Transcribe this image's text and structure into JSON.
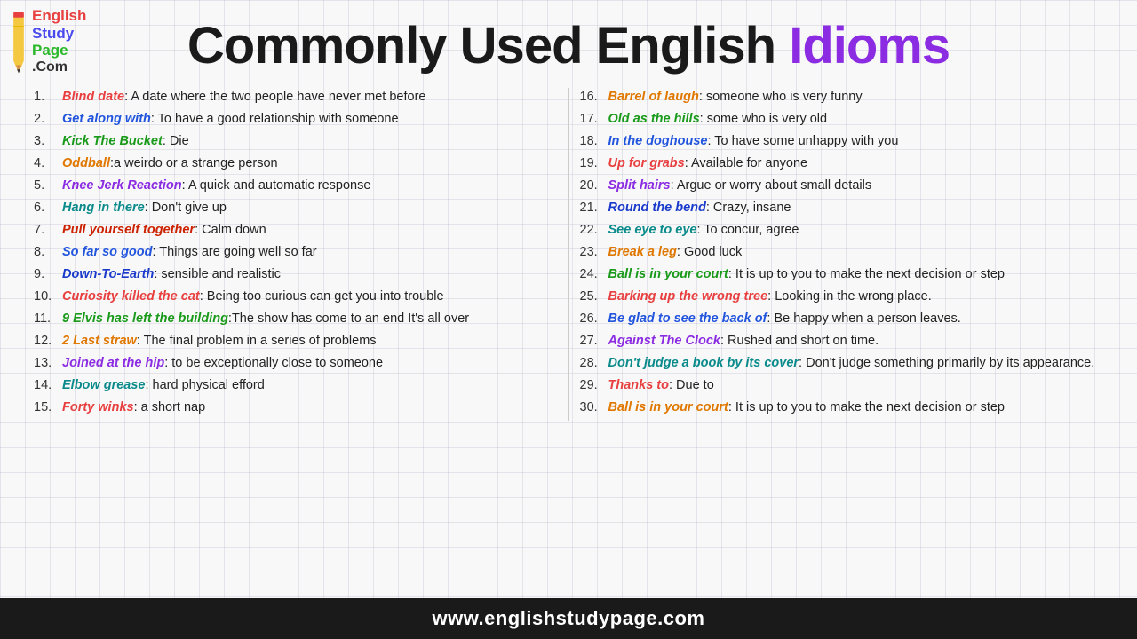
{
  "logo": {
    "english": "English",
    "study": "Study",
    "page": "Page",
    "com": ".Com"
  },
  "title": {
    "black_part": "Commonly Used English ",
    "purple_part": "Idioms"
  },
  "left_idioms": [
    {
      "num": "1.",
      "phrase": "Blind date",
      "color": "c-red",
      "definition": ": A date where the two people have never met before"
    },
    {
      "num": "2.",
      "phrase": "Get along with",
      "color": "c-blue",
      "definition": ": To have a good relationship with someone"
    },
    {
      "num": "3.",
      "phrase": "Kick The Bucket",
      "color": "c-green",
      "definition": ": Die"
    },
    {
      "num": "4.",
      "phrase": "Oddball",
      "color": "c-orange",
      "definition": ":a weirdo or a strange person"
    },
    {
      "num": "5.",
      "phrase": "Knee Jerk Reaction",
      "color": "c-purple",
      "definition": ": A quick and automatic response"
    },
    {
      "num": "6.",
      "phrase": "Hang in there",
      "color": "c-teal",
      "definition": ": Don't give up"
    },
    {
      "num": "7.",
      "phrase": "Pull yourself together",
      "color": "c-darkred",
      "definition": ": Calm down"
    },
    {
      "num": "8.",
      "phrase": "So far so good",
      "color": "c-blue",
      "definition": ": Things are going well so far"
    },
    {
      "num": "9.",
      "phrase": "Down-To-Earth",
      "color": "c-navy",
      "definition": ": sensible and realistic"
    },
    {
      "num": "10.",
      "phrase": "Curiosity killed the cat",
      "color": "c-red",
      "definition": ": Being too curious can get you into trouble"
    },
    {
      "num": "11.",
      "phrase": "9 Elvis has left the building",
      "color": "c-green",
      "definition": ":The show has come to an end It's all over"
    },
    {
      "num": "12.",
      "phrase": "2 Last straw",
      "color": "c-orange",
      "definition": ": The final problem in a series of problems"
    },
    {
      "num": "13.",
      "phrase": "Joined at the hip",
      "color": "c-purple",
      "definition": ": to be exceptionally close to someone"
    },
    {
      "num": "14.",
      "phrase": "Elbow grease",
      "color": "c-teal",
      "definition": ": hard physical efford"
    },
    {
      "num": "15.",
      "phrase": "Forty winks",
      "color": "c-red",
      "definition": ": a short nap"
    }
  ],
  "right_idioms": [
    {
      "num": "16.",
      "phrase": "Barrel of laugh",
      "color": "c-orange",
      "definition": ": someone who is very funny"
    },
    {
      "num": "17.",
      "phrase": "Old as the hills",
      "color": "c-green",
      "definition": ": some who is very old"
    },
    {
      "num": "18.",
      "phrase": "In the doghouse",
      "color": "c-blue",
      "definition": ": To have some unhappy with you"
    },
    {
      "num": "19.",
      "phrase": "Up for grabs",
      "color": "c-red",
      "definition": ": Available for anyone"
    },
    {
      "num": "20.",
      "phrase": "Split hairs",
      "color": "c-purple",
      "definition": ": Argue or worry about small details"
    },
    {
      "num": "21.",
      "phrase": "Round the bend",
      "color": "c-navy",
      "definition": ": Crazy, insane"
    },
    {
      "num": "22.",
      "phrase": "See eye to eye",
      "color": "c-teal",
      "definition": ": To concur, agree"
    },
    {
      "num": "23.",
      "phrase": "Break a leg",
      "color": "c-orange",
      "definition": ": Good luck"
    },
    {
      "num": "24.",
      "phrase": "Ball is in your court",
      "color": "c-green",
      "definition": ": It is up to you to make the next decision or step"
    },
    {
      "num": "25.",
      "phrase": "Barking up the wrong tree",
      "color": "c-red",
      "definition": ": Looking in the wrong place."
    },
    {
      "num": "26.",
      "phrase": "Be glad to see the back of",
      "color": "c-blue",
      "definition": ": Be happy when a person leaves."
    },
    {
      "num": "27.",
      "phrase": "Against The Clock",
      "color": "c-purple",
      "definition": ": Rushed and short on time."
    },
    {
      "num": "28.",
      "phrase": "Don't judge a book by its cover",
      "color": "c-teal",
      "definition": ": Don't judge something primarily by its appearance."
    },
    {
      "num": "29.",
      "phrase": "Thanks to",
      "color": "c-red",
      "definition": ": Due to"
    },
    {
      "num": "30.",
      "phrase": "Ball is in your court",
      "color": "c-orange",
      "definition": ": It is up to you to make the next decision or step"
    }
  ],
  "footer": {
    "url": "www.englishstudypage.com"
  }
}
